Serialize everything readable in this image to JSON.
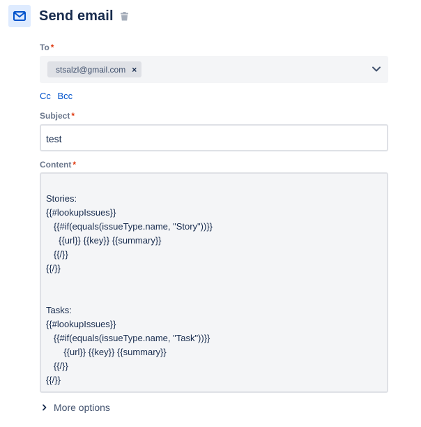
{
  "header": {
    "icon": "mail-icon",
    "title": "Send email",
    "delete_icon": "trash-icon"
  },
  "to": {
    "label": "To",
    "required_marker": "*",
    "recipients": [
      "stsalzl@gmail.com"
    ],
    "remove_icon": "×",
    "dropdown_icon": "chevron-down-icon"
  },
  "cc_links": {
    "cc": "Cc",
    "bcc": "Bcc"
  },
  "subject": {
    "label": "Subject",
    "required_marker": "*",
    "value": "test"
  },
  "content": {
    "label": "Content",
    "required_marker": "*",
    "value": "\nStories:\n{{#lookupIssues}}\n   {{#if(equals(issueType.name, \"Story\"))}}\n     {{url}} {{key}} {{summary}}\n   {{/}}\n{{/}}\n\n\nTasks:\n{{#lookupIssues}}\n   {{#if(equals(issueType.name, \"Task\"))}}\n       {{url}} {{key}} {{summary}}\n   {{/}}\n{{/}}"
  },
  "more_options": {
    "label": "More options",
    "icon": "chevron-right-icon"
  },
  "colors": {
    "accent": "#0052cc",
    "required": "#de350b",
    "icon_bg": "#deebff"
  }
}
